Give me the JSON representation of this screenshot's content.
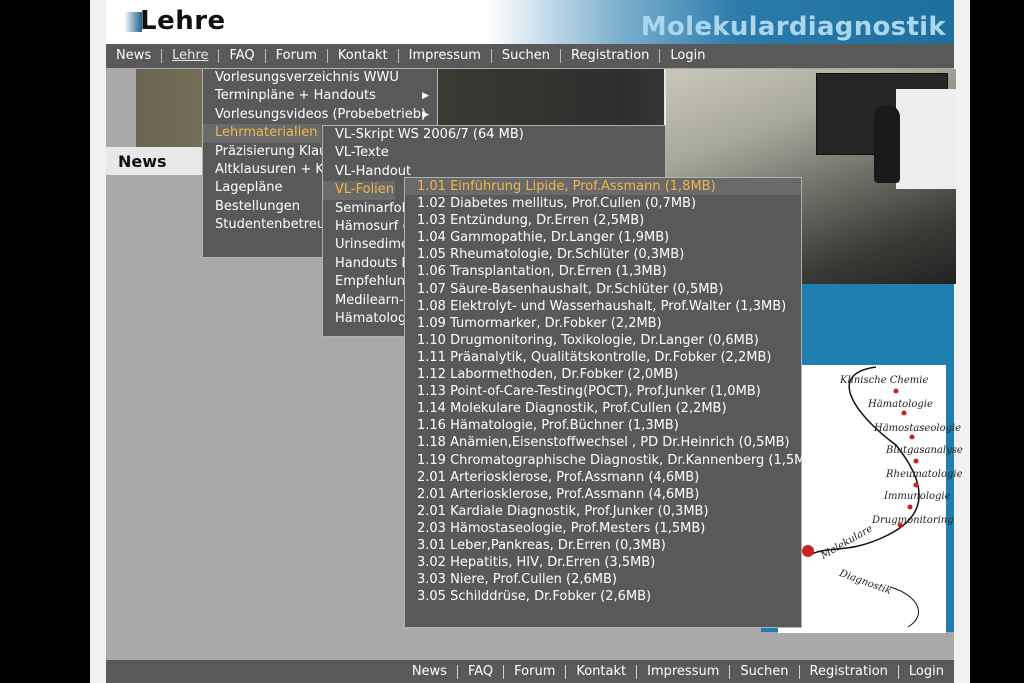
{
  "header": {
    "section_title": "Lehre",
    "brand": "Molekulardiagnostik"
  },
  "topnav": [
    "News",
    "Lehre",
    "FAQ",
    "Forum",
    "Kontakt",
    "Impressum",
    "Suchen",
    "Registration",
    "Login"
  ],
  "topnav_active": "Lehre",
  "news_label": "News",
  "menu_lehre": [
    {
      "label": "Vorlesungsverzeichnis WWU",
      "arrow": ""
    },
    {
      "label": "Terminpläne + Handouts",
      "arrow": "▶"
    },
    {
      "label": "Vorlesungsvideos (Probebetrieb)",
      "arrow": "▶"
    },
    {
      "label": "Lehrmaterialien",
      "arrow": "",
      "highlighted": true
    },
    {
      "label": "Präzisierung Klaus",
      "arrow": ""
    },
    {
      "label": "Altklausuren + Kl",
      "arrow": ""
    },
    {
      "label": "Lagepläne",
      "arrow": "▶"
    },
    {
      "label": "Bestellungen",
      "arrow": "▶"
    },
    {
      "label": "Studentenbetreuu",
      "arrow": ""
    }
  ],
  "menu_lehrmaterialien": [
    {
      "label": "VL-Skript WS 2006/7 (64 MB)"
    },
    {
      "label": "VL-Texte"
    },
    {
      "label": "VL-Handout"
    },
    {
      "label": "VL-Folien",
      "highlighted": true
    },
    {
      "label": "Seminarfol"
    },
    {
      "label": "Hämosurf ("
    },
    {
      "label": "Urinsedime"
    },
    {
      "label": "Handouts L"
    },
    {
      "label": "Empfehlung"
    },
    {
      "label": "Medilearn-F"
    },
    {
      "label": "Hämatologi"
    }
  ],
  "menu_vl_folien": [
    {
      "label": "1.01 Einführung Lipide, Prof.Assmann (1,8MB)",
      "highlighted": true
    },
    {
      "label": "1.02 Diabetes mellitus, Prof.Cullen (0,7MB)"
    },
    {
      "label": "1.03 Entzündung, Dr.Erren (2,5MB)"
    },
    {
      "label": "1.04 Gammopathie, Dr.Langer (1,9MB)"
    },
    {
      "label": "1.05 Rheumatologie, Dr.Schlüter (0,3MB)"
    },
    {
      "label": "1.06 Transplantation, Dr.Erren (1,3MB)"
    },
    {
      "label": "1.07 Säure-Basenhaushalt, Dr.Schlüter (0,5MB)"
    },
    {
      "label": "1.08 Elektrolyt- und Wasserhaushalt, Prof.Walter (1,3MB)"
    },
    {
      "label": "1.09 Tumormarker, Dr.Fobker (2,2MB)"
    },
    {
      "label": "1.10 Drugmonitoring, Toxikologie, Dr.Langer (0,6MB)"
    },
    {
      "label": "1.11 Präanalytik, Qualitätskontrolle, Dr.Fobker (2,2MB)"
    },
    {
      "label": "1.12 Labormethoden, Dr.Fobker (2,0MB)"
    },
    {
      "label": "1.13 Point-of-Care-Testing(POCT), Prof.Junker (1,0MB)"
    },
    {
      "label": "1.14 Molekulare Diagnostik, Prof.Cullen (2,2MB)"
    },
    {
      "label": "1.16 Hämatologie, Prof.Büchner (1,3MB)"
    },
    {
      "label": "1.18 Anämien,Eisenstoffwechsel , PD Dr.Heinrich (0,5MB)"
    },
    {
      "label": "1.19 Chromatographische Diagnostik, Dr.Kannenberg (1,5MB)"
    },
    {
      "label": "2.01 Arteriosklerose, Prof.Assmann (4,6MB)"
    },
    {
      "label": "2.01 Arteriosklerose, Prof.Assmann (4,6MB)"
    },
    {
      "label": "2.01 Kardiale Diagnostik, Prof.Junker (0,3MB)"
    },
    {
      "label": "2.03 Hämostaseologie, Prof.Mesters (1,5MB)"
    },
    {
      "label": "3.01 Leber,Pankreas, Dr.Erren (0,3MB)"
    },
    {
      "label": "3.02 Hepatitis, HIV, Dr.Erren (3,5MB)"
    },
    {
      "label": "3.03 Niere, Prof.Cullen (2,6MB)"
    },
    {
      "label": "3.05 Schilddrüse, Dr.Fobker (2,6MB)"
    }
  ],
  "diagram_labels": [
    "Klinische Chemie",
    "Hämatologie",
    "Hämostaseologie",
    "Blutgasanalyse",
    "Rheumatologie",
    "Immunologie",
    "Drugmonitoring",
    "Molekulare",
    "Diagnostik"
  ],
  "footer": [
    "News",
    "FAQ",
    "Forum",
    "Kontakt",
    "Impressum",
    "Suchen",
    "Registration",
    "Login"
  ],
  "colors": {
    "nav_bg": "#595959",
    "menu_highlight_text": "#f0b64a",
    "side_panel_blue": "#1e7fb0",
    "brand_text": "#a9d7ef"
  }
}
